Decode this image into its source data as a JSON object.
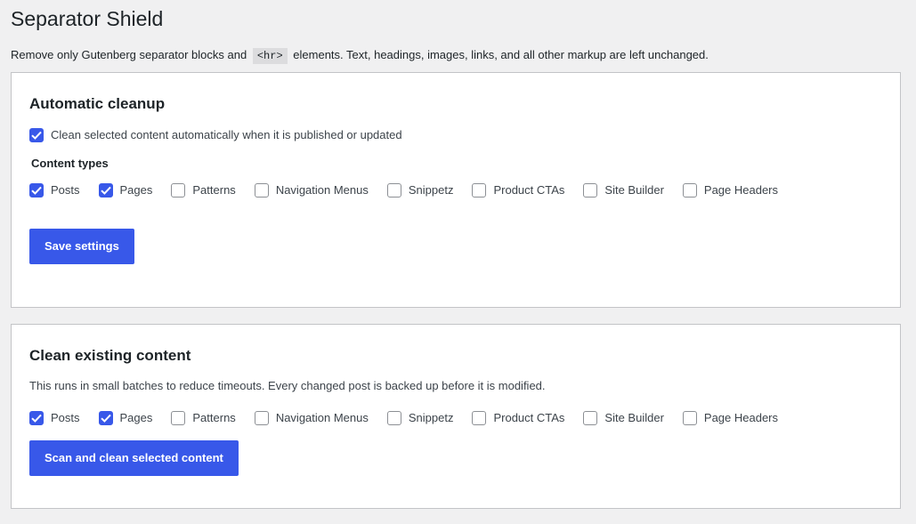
{
  "page": {
    "title": "Separator Shield",
    "intro_before": "Remove only Gutenberg separator blocks and",
    "intro_code": "<hr>",
    "intro_after": "elements. Text, headings, images, links, and all other markup are left unchanged."
  },
  "auto_cleanup": {
    "heading": "Automatic cleanup",
    "auto_label": "Clean selected content automatically when it is published or updated",
    "auto_checked": true,
    "content_types_label": "Content types",
    "types": [
      {
        "label": "Posts",
        "checked": true
      },
      {
        "label": "Pages",
        "checked": true
      },
      {
        "label": "Patterns",
        "checked": false
      },
      {
        "label": "Navigation Menus",
        "checked": false
      },
      {
        "label": "Snippetz",
        "checked": false
      },
      {
        "label": "Product CTAs",
        "checked": false
      },
      {
        "label": "Site Builder",
        "checked": false
      },
      {
        "label": "Page Headers",
        "checked": false
      }
    ],
    "save_label": "Save settings"
  },
  "existing": {
    "heading": "Clean existing content",
    "description": "This runs in small batches to reduce timeouts. Every changed post is backed up before it is modified.",
    "types": [
      {
        "label": "Posts",
        "checked": true
      },
      {
        "label": "Pages",
        "checked": true
      },
      {
        "label": "Patterns",
        "checked": false
      },
      {
        "label": "Navigation Menus",
        "checked": false
      },
      {
        "label": "Snippetz",
        "checked": false
      },
      {
        "label": "Product CTAs",
        "checked": false
      },
      {
        "label": "Site Builder",
        "checked": false
      },
      {
        "label": "Page Headers",
        "checked": false
      }
    ],
    "scan_label": "Scan and clean selected content"
  },
  "colors": {
    "accent": "#3858e9",
    "background": "#f0f0f1",
    "card": "#ffffff",
    "border": "#c3c4c7"
  }
}
